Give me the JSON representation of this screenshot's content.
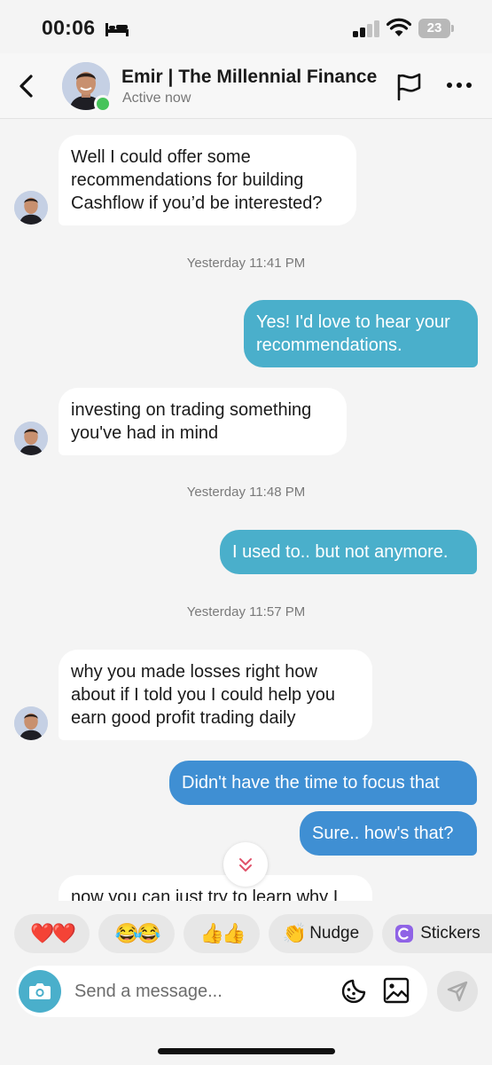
{
  "status_bar": {
    "time": "00:06",
    "battery": "23"
  },
  "header": {
    "contact_name": "Emir | The Millennial Finance",
    "presence": "Active now"
  },
  "messages": [
    {
      "dir": "in",
      "text": "Well I could offer some recommendations for building Cashflow if you’d be interested?"
    },
    {
      "type": "timestamp",
      "text": "Yesterday 11:41 PM"
    },
    {
      "dir": "out",
      "text": "Yes! I'd love to hear your recommendations."
    },
    {
      "dir": "in",
      "text": "investing on trading something you've had in mind"
    },
    {
      "type": "timestamp",
      "text": "Yesterday 11:48 PM"
    },
    {
      "dir": "out",
      "text": "I used to.. but not anymore."
    },
    {
      "type": "timestamp",
      "text": "Yesterday 11:57 PM"
    },
    {
      "dir": "in",
      "text": "why you made losses right how about if I told you I could help you earn good profit trading daily"
    },
    {
      "dir": "out",
      "text": "Didn't have the time to focus that"
    },
    {
      "dir": "out",
      "text": "Sure.. how's that?"
    },
    {
      "dir": "in",
      "text": "now you can just try to learn why I"
    }
  ],
  "quick_reactions": [
    {
      "emoji": "❤️❤️"
    },
    {
      "emoji": "😂😂"
    },
    {
      "emoji": "👍👍"
    },
    {
      "emoji": "👏",
      "label": "Nudge"
    },
    {
      "label": "Stickers"
    }
  ],
  "composer": {
    "placeholder": "Send a message..."
  },
  "icons": {
    "back": "chevron-left-icon",
    "flag": "flag-icon",
    "more": "more-dots-icon",
    "camera": "camera-icon",
    "sticker": "sticker-icon",
    "image": "image-icon",
    "send": "send-icon",
    "scroll_down": "double-chevron-down-icon"
  },
  "colors": {
    "outgoing_bubble": "#4aafcb",
    "outgoing_bubble_alt": "#3f8fd3",
    "online": "#46c35a",
    "accent": "#4aafcb"
  }
}
